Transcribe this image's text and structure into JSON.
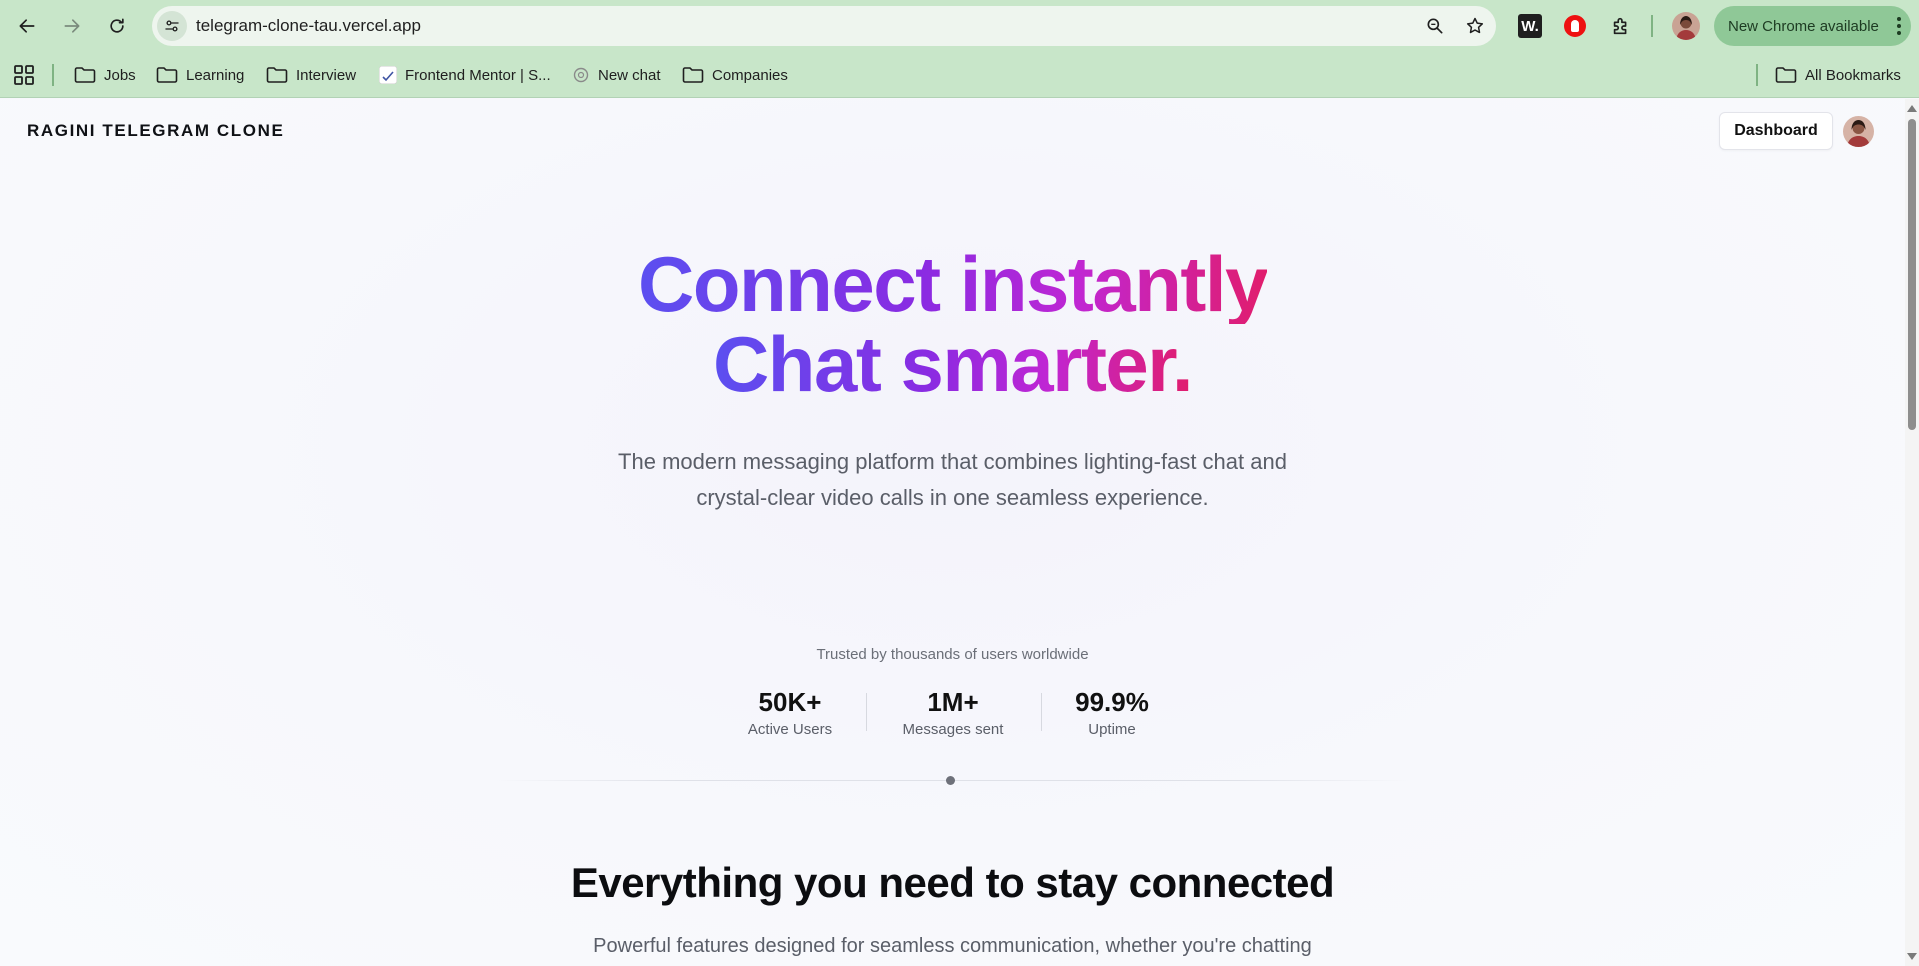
{
  "browser": {
    "url": "telegram-clone-tau.vercel.app",
    "update_label": "New Chrome available",
    "ext_w_label": "W.",
    "bookmarks": [
      {
        "label": "Jobs",
        "icon": "folder-icon"
      },
      {
        "label": "Learning",
        "icon": "folder-icon"
      },
      {
        "label": "Interview",
        "icon": "folder-icon"
      },
      {
        "label": "Frontend Mentor | S...",
        "icon": "frontend-mentor-favicon"
      },
      {
        "label": "New chat",
        "icon": "openai-favicon"
      },
      {
        "label": "Companies",
        "icon": "folder-icon"
      }
    ],
    "all_bookmarks_label": "All Bookmarks",
    "colors": {
      "frame": "#c8e6c9",
      "update_button": "#8fc897"
    }
  },
  "header": {
    "brand": "RAGINI TELEGRAM CLONE",
    "dashboard_label": "Dashboard"
  },
  "hero": {
    "title_line1": "Connect instantly",
    "title_line2": "Chat smarter.",
    "subtitle": "The modern messaging platform that combines lighting-fast chat and crystal-clear video calls in one seamless experience.",
    "gradient_colors": [
      "#5b4ff0",
      "#8a2be2",
      "#c026d3",
      "#e11d6c"
    ]
  },
  "trust": {
    "caption": "Trusted by thousands of users worldwide",
    "stats": [
      {
        "value": "50K+",
        "label": "Active Users"
      },
      {
        "value": "1M+",
        "label": "Messages sent"
      },
      {
        "value": "99.9%",
        "label": "Uptime"
      }
    ]
  },
  "features": {
    "title": "Everything you need to stay connected",
    "subtitle": "Powerful features designed for seamless communication, whether you're chatting"
  }
}
